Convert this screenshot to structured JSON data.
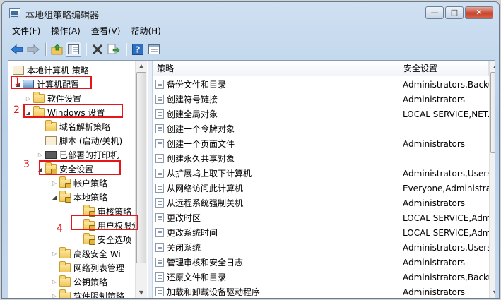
{
  "window": {
    "title": "本地组策略编辑器",
    "buttons": {
      "minimize": "—",
      "maximize": "□",
      "close": "✕"
    }
  },
  "menu": [
    "文件(F)",
    "操作(A)",
    "查看(V)",
    "帮助(H)"
  ],
  "toolbar": {
    "buttons": [
      "back-icon",
      "forward-icon",
      "up-folder-icon",
      "show-hide-tree-icon",
      "delete-icon",
      "export-icon",
      "help-icon",
      "properties-icon"
    ]
  },
  "tree": {
    "items": [
      {
        "label": "本地计算机 策略",
        "icon": "scroll-icon",
        "indent": 0,
        "expander": ""
      },
      {
        "label": "计算机配置",
        "icon": "computer-icon",
        "indent": 1,
        "expander": "◢"
      },
      {
        "label": "软件设置",
        "icon": "folder-icon",
        "indent": 2,
        "expander": "▷"
      },
      {
        "label": "Windows 设置",
        "icon": "folder-icon",
        "indent": 2,
        "expander": "◢"
      },
      {
        "label": "域名解析策略",
        "icon": "folder-icon",
        "indent": 3,
        "expander": ""
      },
      {
        "label": "脚本 (启动/关机)",
        "icon": "scroll-icon",
        "indent": 3,
        "expander": ""
      },
      {
        "label": "已部署的打印机",
        "icon": "printer-icon",
        "indent": 3,
        "expander": "▷"
      },
      {
        "label": "安全设置",
        "icon": "lock-folder-icon",
        "indent": 3,
        "expander": "◢"
      },
      {
        "label": "帐户策略",
        "icon": "lock-folder-icon",
        "indent": 4,
        "expander": "▷"
      },
      {
        "label": "本地策略",
        "icon": "lock-folder-icon",
        "indent": 4,
        "expander": "◢"
      },
      {
        "label": "审核策略",
        "icon": "lock-folder-icon",
        "indent": 5,
        "expander": ""
      },
      {
        "label": "用户权限分",
        "icon": "lock-folder-icon",
        "indent": 5,
        "expander": ""
      },
      {
        "label": "安全选项",
        "icon": "lock-folder-icon",
        "indent": 5,
        "expander": ""
      },
      {
        "label": "高级安全 Wi",
        "icon": "folder-icon",
        "indent": 4,
        "expander": "▷"
      },
      {
        "label": "网络列表管理",
        "icon": "folder-icon",
        "indent": 4,
        "expander": ""
      },
      {
        "label": "公钥策略",
        "icon": "folder-icon",
        "indent": 4,
        "expander": "▷"
      },
      {
        "label": "软件限制策略",
        "icon": "folder-icon",
        "indent": 4,
        "expander": "▷"
      }
    ]
  },
  "list": {
    "headers": {
      "policy": "策略",
      "setting": "安全设置"
    },
    "rows": [
      {
        "policy": "备份文件和目录",
        "setting": "Administrators,Backu"
      },
      {
        "policy": "创建符号链接",
        "setting": "Administrators"
      },
      {
        "policy": "创建全局对象",
        "setting": "LOCAL SERVICE,NET."
      },
      {
        "policy": "创建一个令牌对象",
        "setting": ""
      },
      {
        "policy": "创建一个页面文件",
        "setting": "Administrators"
      },
      {
        "policy": "创建永久共享对象",
        "setting": ""
      },
      {
        "policy": "从扩展坞上取下计算机",
        "setting": "Administrators,Users"
      },
      {
        "policy": "从网络访问此计算机",
        "setting": "Everyone,Administrat"
      },
      {
        "policy": "从远程系统强制关机",
        "setting": "Administrators"
      },
      {
        "policy": "更改时区",
        "setting": "LOCAL SERVICE,Adm"
      },
      {
        "policy": "更改系统时间",
        "setting": "LOCAL SERVICE,Adm"
      },
      {
        "policy": "关闭系统",
        "setting": "Administrators,Users,"
      },
      {
        "policy": "管理审核和安全日志",
        "setting": "Administrators"
      },
      {
        "policy": "还原文件和目录",
        "setting": "Administrators,Backu"
      },
      {
        "policy": "加载和卸载设备驱动程序",
        "setting": "Administrators"
      }
    ]
  },
  "annotations": {
    "numbers": [
      "1",
      "2",
      "3",
      "4"
    ],
    "color": "#e4161a"
  }
}
